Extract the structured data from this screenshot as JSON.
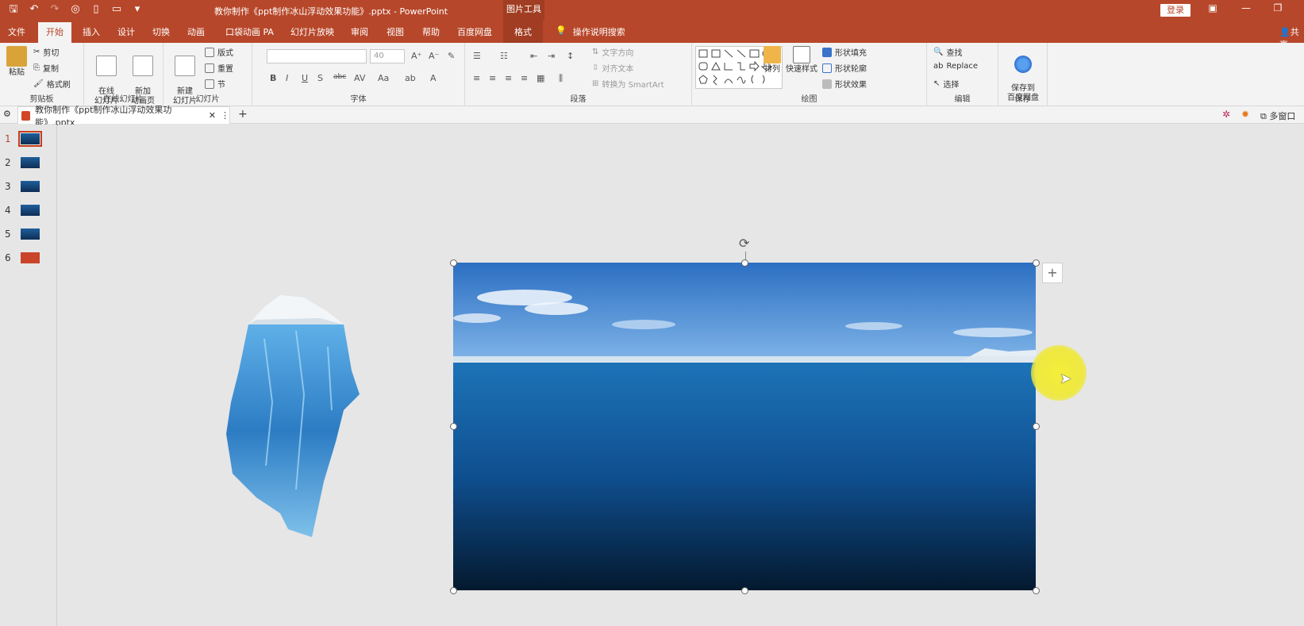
{
  "titlebar": {
    "title": "教你制作《ppt制作冰山浮动效果功能》.pptx  -  PowerPoint",
    "context_tools": "图片工具",
    "login": "登录"
  },
  "tabs": {
    "file": "文件",
    "home": "开始",
    "insert": "插入",
    "design": "设计",
    "transitions": "切换",
    "animations": "动画",
    "pocket": "口袋动画 PA",
    "slideshow": "幻灯片放映",
    "review": "审阅",
    "view": "视图",
    "help": "帮助",
    "baidu": "百度网盘",
    "format": "格式",
    "tellme": "操作说明搜索",
    "share": "共享"
  },
  "ribbon": {
    "clipboard": {
      "paste": "粘贴",
      "cut": "剪切",
      "copy": "复制",
      "format_painter": "格式刷",
      "label": "剪贴板"
    },
    "online": {
      "online_slides": "在线\n幻灯片",
      "new_anim": "新加\n动画页",
      "label": "在线幻灯片"
    },
    "slides": {
      "new_slide": "新建\n幻灯片",
      "layout": "版式",
      "reset": "重置",
      "section": "节",
      "label": "幻灯片"
    },
    "font": {
      "size": "40",
      "label": "字体"
    },
    "paragraph": {
      "text_direction": "文字方向",
      "align_text": "对齐文本",
      "smartart": "转换为 SmartArt",
      "label": "段落"
    },
    "drawing": {
      "arrange": "排列",
      "quick_styles": "快速样式",
      "shape_fill": "形状填充",
      "shape_outline": "形状轮廓",
      "shape_effects": "形状效果",
      "label": "绘图"
    },
    "editing": {
      "find": "查找",
      "replace": "Replace",
      "select": "选择",
      "label": "编辑"
    },
    "save": {
      "save_baidu": "保存到\n百度网盘",
      "label": "保存"
    }
  },
  "docbar": {
    "doc_tab": "教你制作《ppt制作冰山浮动效果功能》.pptx",
    "multi_window": "多窗口"
  },
  "slides": [
    {
      "num": "1",
      "selected": true
    },
    {
      "num": "2",
      "selected": false
    },
    {
      "num": "3",
      "selected": false
    },
    {
      "num": "4",
      "selected": false
    },
    {
      "num": "5",
      "selected": false
    },
    {
      "num": "6",
      "selected": false
    }
  ],
  "colors": {
    "accent": "#b7472a",
    "ribbon_bg": "#f3f3f3",
    "canvas_bg": "#e6e6e6"
  }
}
